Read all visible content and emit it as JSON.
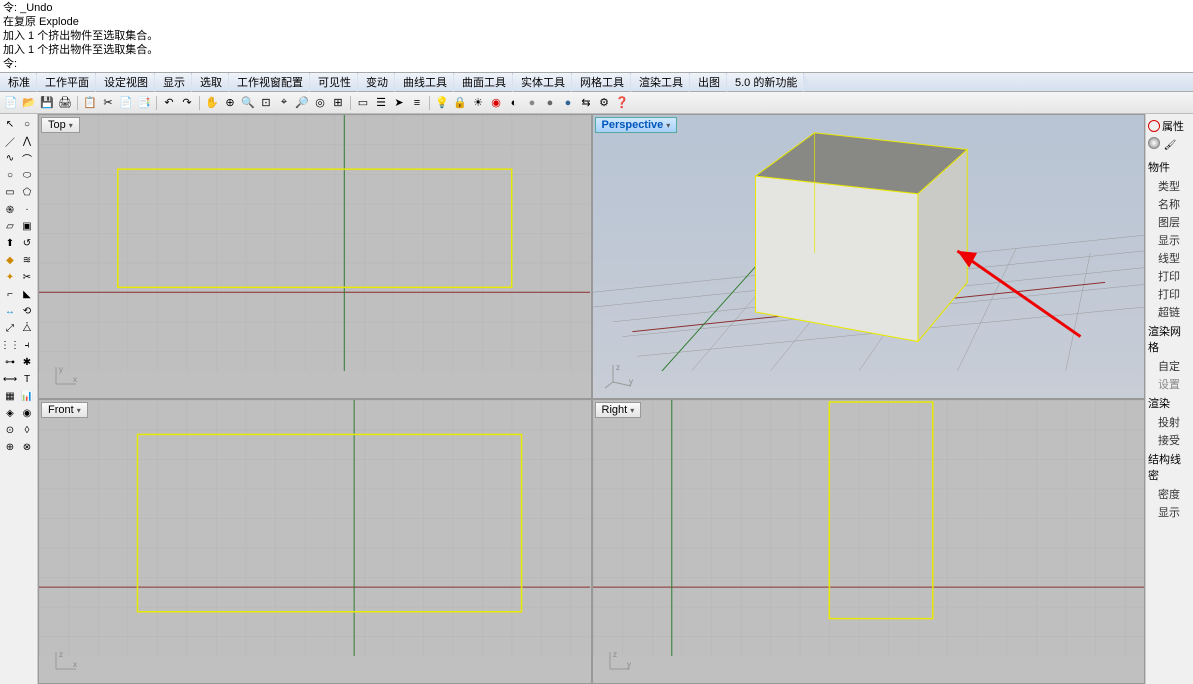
{
  "command_history": {
    "line1": "令: _Undo",
    "line2": "在复原 Explode",
    "line3": "加入 1 个挤出物件至选取集合。",
    "line4": "加入 1 个挤出物件至选取集合。",
    "line5": "令:"
  },
  "menu": {
    "items": [
      "标准",
      "工作平面",
      "设定视图",
      "显示",
      "选取",
      "工作视窗配置",
      "可见性",
      "变动",
      "曲线工具",
      "曲面工具",
      "实体工具",
      "网格工具",
      "渲染工具",
      "出图",
      "5.0 的新功能"
    ]
  },
  "viewports": {
    "top": "Top",
    "perspective": "Perspective",
    "front": "Front",
    "right": "Right",
    "axes_xy": "y\n   x",
    "axes_xz": "z\n   x",
    "axes_yz": "z\n   y"
  },
  "panel": {
    "props": "属性",
    "object": "物件",
    "items1": [
      "类型",
      "名称",
      "图层",
      "显示",
      "线型",
      "打印",
      "打印",
      "超链"
    ],
    "render": "渲染网格",
    "items2": [
      "自定",
      "设置"
    ],
    "shade": "渲染",
    "items3": [
      "投射",
      "接受"
    ],
    "iso": "结构线密",
    "items4": [
      "密度",
      "显示"
    ]
  }
}
